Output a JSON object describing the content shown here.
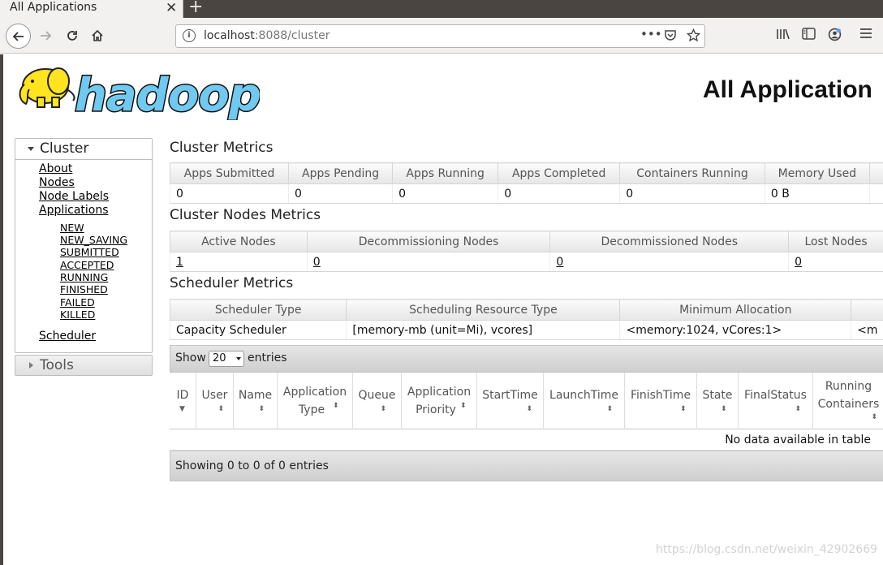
{
  "browser": {
    "tab_title": "All Applications",
    "tab_close": "✕",
    "new_tab": "+",
    "url_host": "localhost",
    "url_rest": ":8088/cluster",
    "icons": [
      "back-icon",
      "forward-icon",
      "reload-icon",
      "home-icon",
      "info-icon",
      "more-icon",
      "pocket-icon",
      "bookmark-star-icon",
      "library-icon",
      "sidebar-icon",
      "account-icon",
      "menu-icon"
    ]
  },
  "page": {
    "title": "All Application",
    "logo_text": "hadoop"
  },
  "sidebar": {
    "cluster_label": "Cluster",
    "links": [
      "About",
      "Nodes",
      "Node Labels",
      "Applications"
    ],
    "app_states": [
      "NEW",
      "NEW_SAVING",
      "SUBMITTED",
      "ACCEPTED",
      "RUNNING",
      "FINISHED",
      "FAILED",
      "KILLED"
    ],
    "scheduler_link": "Scheduler",
    "tools_label": "Tools"
  },
  "cluster_metrics": {
    "title": "Cluster Metrics",
    "headers": [
      "Apps Submitted",
      "Apps Pending",
      "Apps Running",
      "Apps Completed",
      "Containers Running",
      "Memory Used"
    ],
    "values": [
      "0",
      "0",
      "0",
      "0",
      "0",
      "0 B"
    ]
  },
  "node_metrics": {
    "title": "Cluster Nodes Metrics",
    "headers": [
      "Active Nodes",
      "Decommissioning Nodes",
      "Decommissioned Nodes",
      "Lost Nodes"
    ],
    "values": [
      "1",
      "0",
      "0",
      "0"
    ]
  },
  "scheduler_metrics": {
    "title": "Scheduler Metrics",
    "headers": [
      "Scheduler Type",
      "Scheduling Resource Type",
      "Minimum Allocation",
      ""
    ],
    "values": [
      "Capacity Scheduler",
      "[memory-mb (unit=Mi), vcores]",
      "<memory:1024, vCores:1>",
      "<m"
    ]
  },
  "apps_table": {
    "show_label": "Show",
    "entries_label": "entries",
    "page_size": "20",
    "columns": [
      [
        "ID"
      ],
      [
        "User"
      ],
      [
        "Name"
      ],
      [
        "Application",
        "Type"
      ],
      [
        "Queue"
      ],
      [
        "Application",
        "Priority"
      ],
      [
        "StartTime"
      ],
      [
        "LaunchTime"
      ],
      [
        "FinishTime"
      ],
      [
        "State"
      ],
      [
        "FinalStatus"
      ],
      [
        "Running",
        "Containers"
      ]
    ],
    "empty_text": "No data available in table",
    "footer_text": "Showing 0 to 0 of 0 entries"
  },
  "watermark": "https://blog.csdn.net/weixin_42902669"
}
